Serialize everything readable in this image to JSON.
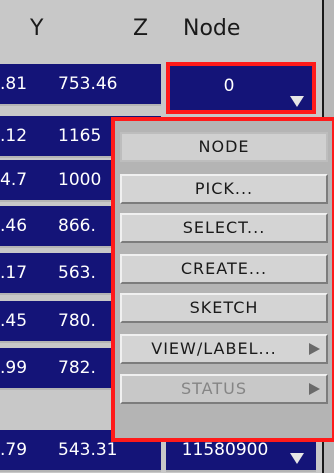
{
  "header": {
    "col_y": "Y",
    "col_z": "Z",
    "col_node": "Node"
  },
  "rows": [
    {
      "y": ".81",
      "z": "753.46",
      "node": "0"
    },
    {
      "y": ".12",
      "z": "1165",
      "node": ""
    },
    {
      "y": "4.7",
      "z": "1000",
      "node": ""
    },
    {
      "y": ".46",
      "z": "866.",
      "node": ""
    },
    {
      "y": ".17",
      "z": "563.",
      "node": ""
    },
    {
      "y": ".45",
      "z": "780.",
      "node": ""
    },
    {
      "y": ".99",
      "z": "782.",
      "node": ""
    },
    {
      "y": ".79",
      "z": "543.31",
      "node": "11580900"
    }
  ],
  "menu": {
    "title": "NODE",
    "items": [
      {
        "label": "PICK...",
        "enabled": true,
        "submenu": false
      },
      {
        "label": "SELECT...",
        "enabled": true,
        "submenu": false
      },
      {
        "label": "CREATE...",
        "enabled": true,
        "submenu": false
      },
      {
        "label": "SKETCH",
        "enabled": true,
        "submenu": false
      },
      {
        "label": "VIEW/LABEL...",
        "enabled": true,
        "submenu": true
      },
      {
        "label": "STATUS",
        "enabled": false,
        "submenu": true
      }
    ]
  },
  "colors": {
    "cell_bg": "#141478",
    "highlight": "#ff1a1a",
    "panel_bg": "#c8c8c8"
  }
}
